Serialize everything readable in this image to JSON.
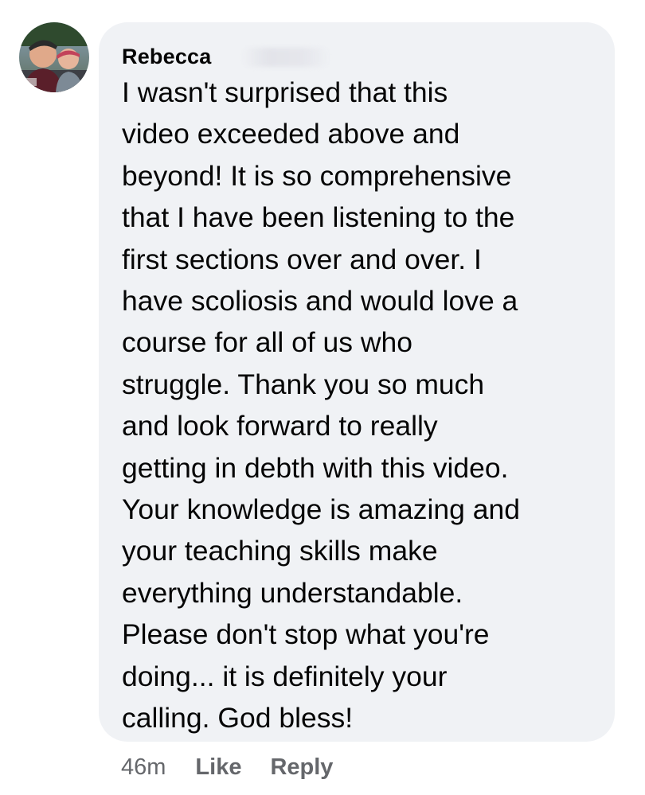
{
  "comment": {
    "author": "Rebecca",
    "lines": [
      "I wasn't surprised that this",
      "video exceeded above and",
      "beyond! It is so comprehensive",
      "that I have been listening to the",
      "first sections over and over. I",
      "have scoliosis and would love a",
      "course for all of us who",
      "struggle. Thank you so much",
      "and look forward to really",
      "getting in debth with this video.",
      "Your knowledge is amazing and",
      "your teaching skills make",
      "everything understandable.",
      "Please don't stop what you're",
      "doing... it is definitely your",
      "calling. God bless!"
    ]
  },
  "actions": {
    "time": "46m",
    "like_label": "Like",
    "reply_label": "Reply"
  },
  "colors": {
    "bubble_background": "#f0f2f5",
    "text": "#050505",
    "secondary_text": "#65676b"
  }
}
